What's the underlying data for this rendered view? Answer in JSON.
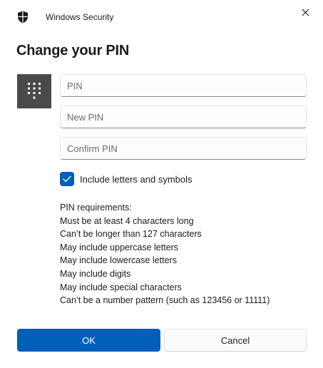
{
  "window": {
    "title": "Windows Security",
    "app_icon": "shield-icon",
    "close_icon": "close-icon"
  },
  "heading": "Change your PIN",
  "pin_tile_icon": "keypad-icon",
  "fields": {
    "pin": {
      "value": "",
      "placeholder": "PIN"
    },
    "new_pin": {
      "value": "",
      "placeholder": "New PIN"
    },
    "confirm_pin": {
      "value": "",
      "placeholder": "Confirm PIN"
    }
  },
  "include_letters": {
    "label": "Include letters and symbols",
    "checked": true
  },
  "requirements": {
    "title": "PIN requirements:",
    "items": [
      "Must be at least 4 characters long",
      "Can’t be longer than 127 characters",
      "May include uppercase letters",
      "May include lowercase letters",
      "May include digits",
      "May include special characters",
      "Can’t be a number pattern (such as 123456 or 11111)"
    ]
  },
  "buttons": {
    "ok": "OK",
    "cancel": "Cancel"
  },
  "colors": {
    "accent": "#005fb8",
    "tile": "#4a4a4a"
  }
}
